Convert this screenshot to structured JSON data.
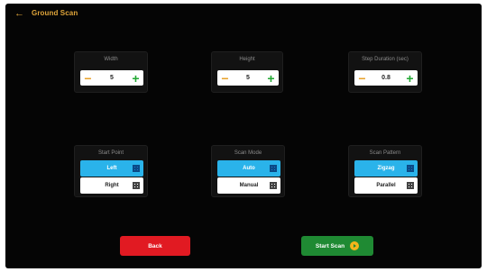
{
  "header": {
    "back_icon": "←",
    "title": "Ground Scan"
  },
  "settings": {
    "width": {
      "label": "Width",
      "value": "5"
    },
    "height": {
      "label": "Height",
      "value": "5"
    },
    "step_duration": {
      "label": "Step Duration (sec)",
      "value": "0.8"
    },
    "minus": "−",
    "plus": "+"
  },
  "start_point": {
    "label": "Start Point",
    "options": [
      "Left",
      "Right"
    ],
    "selected": "Left"
  },
  "scan_mode": {
    "label": "Scan Mode",
    "options": [
      "Auto",
      "Manual"
    ],
    "selected": "Auto"
  },
  "scan_pattern": {
    "label": "Scan Pattern",
    "options": [
      "Zigzag",
      "Parallel"
    ],
    "selected": "Zigzag"
  },
  "actions": {
    "back_label": "Back",
    "start_label": "Start Scan"
  },
  "colors": {
    "accent": "#e0a53a",
    "selected": "#2ab3ea",
    "back": "#e11a22",
    "start": "#1f8a33",
    "minus": "#e8a12a",
    "plus": "#22a833"
  },
  "icons": {
    "option": "grid-icon",
    "start": "play-icon"
  }
}
